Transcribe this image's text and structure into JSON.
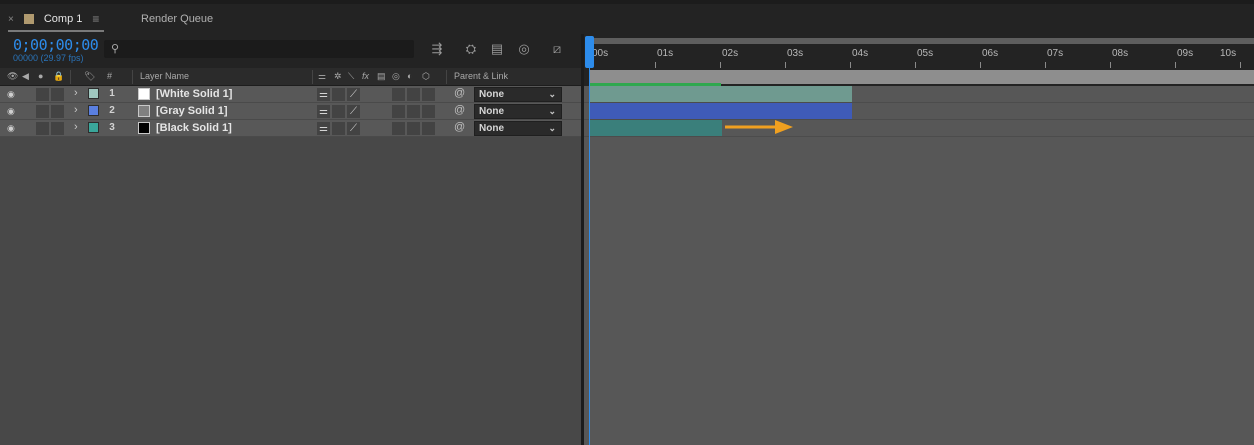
{
  "tabs": {
    "comp": {
      "close": "×",
      "label": "Comp 1",
      "menu": "≡",
      "swatch_color": "#b09a6f"
    },
    "render_queue": {
      "label": "Render Queue"
    }
  },
  "controls": {
    "timecode": "0;00;00;00",
    "frame_fps": "00000 (29.97 fps)",
    "search_icon": "magnifier-icon",
    "icons": [
      "comp-flowchart-icon",
      "draft-3d-icon",
      "frame-blending-icon",
      "motion-blur-icon",
      "graph-editor-icon"
    ]
  },
  "columns": {
    "hash": "#",
    "layer_name": "Layer Name",
    "parent_link": "Parent & Link",
    "fx": "fx"
  },
  "layers": [
    {
      "num": "1",
      "name": "[White Solid 1]",
      "label_color": "#9fc7bf",
      "thumb_color": "#ffffff",
      "parent": "None",
      "bar_color": "#6f9a90",
      "bar_start_s": 0,
      "bar_end_s": 4.0
    },
    {
      "num": "2",
      "name": "[Gray Solid 1]",
      "label_color": "#5a7fe0",
      "thumb_color": "#808080",
      "parent": "None",
      "bar_color": "#3f5bb8",
      "bar_start_s": 0,
      "bar_end_s": 4.0
    },
    {
      "num": "3",
      "name": "[Black Solid 1]",
      "label_color": "#3aa69a",
      "thumb_color": "#000000",
      "parent": "None",
      "bar_color": "#3a7f7b",
      "bar_start_s": 0,
      "bar_end_s": 2.0
    }
  ],
  "ruler": {
    "labels": [
      "00s",
      "01s",
      "02s",
      "03s",
      "04s",
      "05s",
      "06s",
      "07s",
      "08s",
      "09s",
      "10s"
    ]
  },
  "work_area": {
    "rendered_end_s": 2.0
  },
  "annotation": {
    "arrow_color": "#f0a020"
  },
  "colors": {
    "accent": "#2d8ceb",
    "render_green": "#2fa84f"
  }
}
